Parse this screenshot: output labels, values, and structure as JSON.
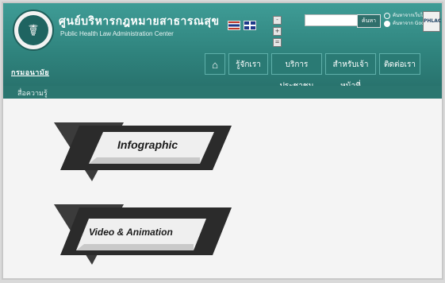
{
  "header": {
    "org_name": "กรมอนามัย",
    "title": "ศูนย์บริหารกฎหมายสาธารณสุข",
    "subtitle": "Public Health Law Administration Center",
    "search": {
      "placeholder": "",
      "button_label": "ค้นหา"
    },
    "radio_options": [
      "ค้นหาจากเว็บไซต์",
      "ค้นหาจาก Google"
    ],
    "corner_logo_text": "PHLAC"
  },
  "nav": {
    "home_icon": "home-icon",
    "items": [
      "รู้จักเรา",
      "บริการประชาชน",
      "สำหรับเจ้าหน้าที่",
      "ติดต่อเรา"
    ]
  },
  "breadcrumb": "สื่อความรู้",
  "banners": [
    {
      "label": "Infographic"
    },
    {
      "label": "Video & Animation"
    }
  ],
  "colors": {
    "header_teal": "#2f837d",
    "nav_teal": "#2a7a74",
    "banner_dark": "#3b3b3b",
    "banner_light": "#f0f0f0"
  }
}
